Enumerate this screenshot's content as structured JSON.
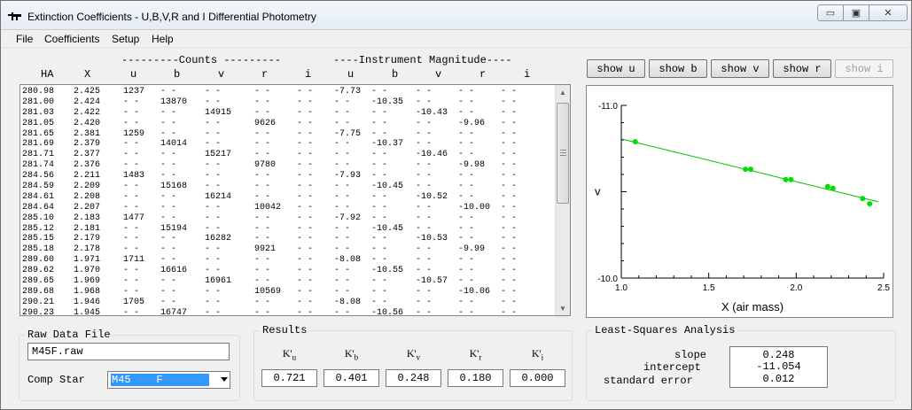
{
  "window": {
    "title": "Extinction Coefficients - U,B,V,R and I Differential Photometry",
    "min_glyph": "▭",
    "max_glyph": "▣",
    "close_glyph": "✕"
  },
  "menu": [
    "File",
    "Coefficients",
    "Setup",
    "Help"
  ],
  "table_header": {
    "group_counts": "---------Counts ---------",
    "group_mag": "----Instrument Magnitude----",
    "columns": [
      "HA",
      "X",
      "u",
      "b",
      "v",
      "r",
      "i",
      "u",
      "b",
      "v",
      "r",
      "i"
    ]
  },
  "rows": [
    [
      "280.98",
      "2.425",
      "1237",
      "- -",
      "- -",
      "- -",
      "- -",
      "-7.73",
      "- -",
      "- -",
      "- -",
      "- -"
    ],
    [
      "281.00",
      "2.424",
      "- -",
      "13870",
      "- -",
      "- -",
      "- -",
      "- -",
      "-10.35",
      "- -",
      "- -",
      "- -"
    ],
    [
      "281.03",
      "2.422",
      "- -",
      "- -",
      "14915",
      "- -",
      "- -",
      "- -",
      "- -",
      "-10.43",
      "- -",
      "- -"
    ],
    [
      "281.05",
      "2.420",
      "- -",
      "- -",
      "- -",
      "9626",
      "- -",
      "- -",
      "- -",
      "- -",
      "-9.96",
      "- -"
    ],
    [
      "281.65",
      "2.381",
      "1259",
      "- -",
      "- -",
      "- -",
      "- -",
      "-7.75",
      "- -",
      "- -",
      "- -",
      "- -"
    ],
    [
      "281.69",
      "2.379",
      "- -",
      "14014",
      "- -",
      "- -",
      "- -",
      "- -",
      "-10.37",
      "- -",
      "- -",
      "- -"
    ],
    [
      "281.71",
      "2.377",
      "- -",
      "- -",
      "15217",
      "- -",
      "- -",
      "- -",
      "- -",
      "-10.46",
      "- -",
      "- -"
    ],
    [
      "281.74",
      "2.376",
      "- -",
      "- -",
      "- -",
      "9780",
      "- -",
      "- -",
      "- -",
      "- -",
      "-9.98",
      "- -"
    ],
    [
      "284.56",
      "2.211",
      "1483",
      "- -",
      "- -",
      "- -",
      "- -",
      "-7.93",
      "- -",
      "- -",
      "- -",
      "- -"
    ],
    [
      "284.59",
      "2.209",
      "- -",
      "15168",
      "- -",
      "- -",
      "- -",
      "- -",
      "-10.45",
      "- -",
      "- -",
      "- -"
    ],
    [
      "284.61",
      "2.208",
      "- -",
      "- -",
      "16214",
      "- -",
      "- -",
      "- -",
      "- -",
      "-10.52",
      "- -",
      "- -"
    ],
    [
      "284.64",
      "2.207",
      "- -",
      "- -",
      "- -",
      "10042",
      "- -",
      "- -",
      "- -",
      "- -",
      "-10.00",
      "- -"
    ],
    [
      "285.10",
      "2.183",
      "1477",
      "- -",
      "- -",
      "- -",
      "- -",
      "-7.92",
      "- -",
      "- -",
      "- -",
      "- -"
    ],
    [
      "285.12",
      "2.181",
      "- -",
      "15194",
      "- -",
      "- -",
      "- -",
      "- -",
      "-10.45",
      "- -",
      "- -",
      "- -"
    ],
    [
      "285.15",
      "2.179",
      "- -",
      "- -",
      "16282",
      "- -",
      "- -",
      "- -",
      "- -",
      "-10.53",
      "- -",
      "- -"
    ],
    [
      "285.18",
      "2.178",
      "- -",
      "- -",
      "- -",
      "9921",
      "- -",
      "- -",
      "- -",
      "- -",
      "-9.99",
      "- -"
    ],
    [
      "289.60",
      "1.971",
      "1711",
      "- -",
      "- -",
      "- -",
      "- -",
      "-8.08",
      "- -",
      "- -",
      "- -",
      "- -"
    ],
    [
      "289.62",
      "1.970",
      "- -",
      "16616",
      "- -",
      "- -",
      "- -",
      "- -",
      "-10.55",
      "- -",
      "- -",
      "- -"
    ],
    [
      "289.65",
      "1.969",
      "- -",
      "- -",
      "16961",
      "- -",
      "- -",
      "- -",
      "- -",
      "-10.57",
      "- -",
      "- -"
    ],
    [
      "289.68",
      "1.968",
      "- -",
      "- -",
      "- -",
      "10569",
      "- -",
      "- -",
      "- -",
      "- -",
      "-10.06",
      "- -"
    ],
    [
      "290.21",
      "1.946",
      "1705",
      "- -",
      "- -",
      "- -",
      "- -",
      "-8.08",
      "- -",
      "- -",
      "- -",
      "- -"
    ],
    [
      "290.23",
      "1.945",
      "- -",
      "16747",
      "- -",
      "- -",
      "- -",
      "- -",
      "-10.56",
      "- -",
      "- -",
      "- -"
    ]
  ],
  "show_buttons": [
    {
      "label": "show u",
      "enabled": true
    },
    {
      "label": "show b",
      "enabled": true
    },
    {
      "label": "show v",
      "enabled": true
    },
    {
      "label": "show r",
      "enabled": true
    },
    {
      "label": "show i",
      "enabled": false
    }
  ],
  "chart_data": {
    "type": "scatter",
    "title": "",
    "xlabel": "X  (air mass)",
    "ylabel": "v",
    "xlim": [
      1.0,
      2.5
    ],
    "ylim": [
      -11.0,
      -10.0
    ],
    "y_inverted": true,
    "x_ticks": [
      "1.0",
      "1.5",
      "2.0",
      "2.5"
    ],
    "y_ticks": [
      "-11.0",
      "-10.0"
    ],
    "grid": false,
    "point_color": "#00e000",
    "line_color": "#00c000",
    "points": [
      {
        "x": 1.08,
        "y": -10.79
      },
      {
        "x": 1.71,
        "y": -10.63
      },
      {
        "x": 1.74,
        "y": -10.63
      },
      {
        "x": 1.94,
        "y": -10.57
      },
      {
        "x": 1.97,
        "y": -10.57
      },
      {
        "x": 2.18,
        "y": -10.53
      },
      {
        "x": 2.21,
        "y": -10.52
      },
      {
        "x": 2.38,
        "y": -10.46
      },
      {
        "x": 2.42,
        "y": -10.43
      }
    ],
    "fit": {
      "slope": 0.248,
      "intercept": -11.054
    }
  },
  "raw_data": {
    "title": "Raw Data File",
    "file": "M45F.raw",
    "comp_label": "Comp Star",
    "comp_value": "M45    F"
  },
  "results": {
    "title": "Results",
    "items": [
      {
        "base": "K'",
        "sub": "u",
        "value": "0.721"
      },
      {
        "base": "K'",
        "sub": "b",
        "value": "0.401"
      },
      {
        "base": "K'",
        "sub": "v",
        "value": "0.248"
      },
      {
        "base": "K'",
        "sub": "r",
        "value": "0.180"
      },
      {
        "base": "K'",
        "sub": "i",
        "value": "0.000"
      }
    ]
  },
  "lsa": {
    "title": "Least-Squares Analysis",
    "slope_label": "slope",
    "intercept_label": "intercept",
    "stderr_label": "standard error",
    "slope": "0.248",
    "intercept": "-11.054",
    "stderr": "0.012"
  }
}
